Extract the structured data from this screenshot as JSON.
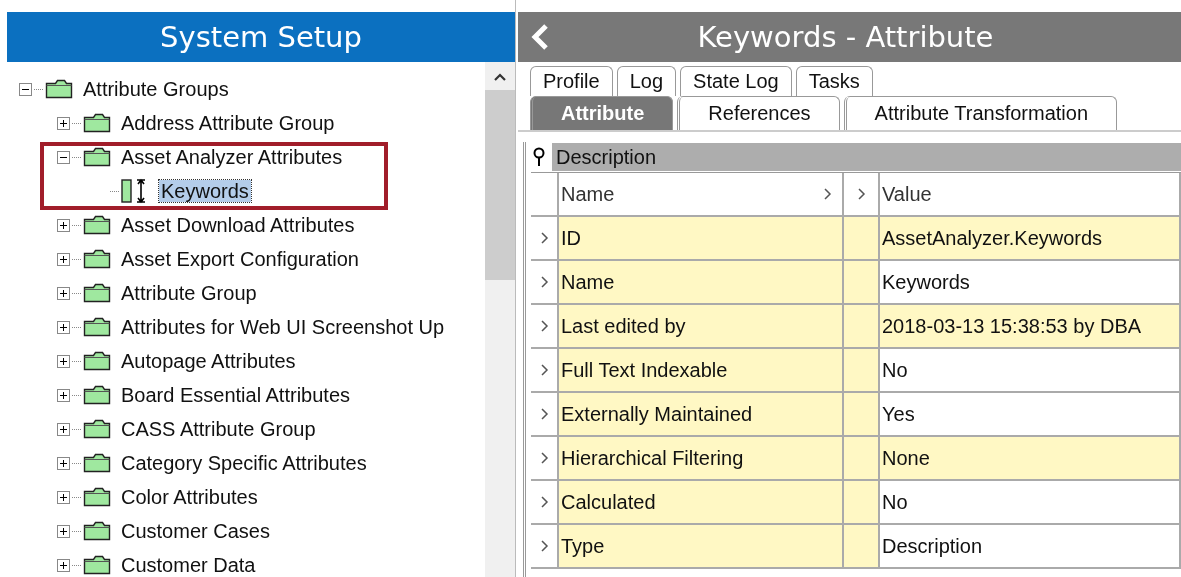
{
  "left_panel": {
    "title": "System Setup",
    "tree": [
      {
        "label": "Attribute Groups",
        "kind": "folder",
        "expanded": true,
        "selected": false,
        "children": [
          {
            "label": "Address Attribute Group",
            "kind": "folder",
            "expanded": false,
            "selected": false
          },
          {
            "label": "Asset Analyzer Attributes",
            "kind": "folder",
            "expanded": true,
            "selected": false,
            "children": [
              {
                "label": "Keywords",
                "kind": "attribute",
                "selected": true
              }
            ]
          },
          {
            "label": "Asset Download Attributes",
            "kind": "folder",
            "expanded": false,
            "selected": false
          },
          {
            "label": "Asset Export Configuration",
            "kind": "folder",
            "expanded": false,
            "selected": false
          },
          {
            "label": "Attribute Group",
            "kind": "folder",
            "expanded": false,
            "selected": false
          },
          {
            "label": "Attributes for Web UI Screenshot Up",
            "kind": "folder",
            "expanded": false,
            "selected": false
          },
          {
            "label": "Autopage Attributes",
            "kind": "folder",
            "expanded": false,
            "selected": false
          },
          {
            "label": "Board Essential Attributes",
            "kind": "folder",
            "expanded": false,
            "selected": false
          },
          {
            "label": "CASS Attribute Group",
            "kind": "folder",
            "expanded": false,
            "selected": false
          },
          {
            "label": "Category Specific Attributes",
            "kind": "folder",
            "expanded": false,
            "selected": false
          },
          {
            "label": "Color Attributes",
            "kind": "folder",
            "expanded": false,
            "selected": false
          },
          {
            "label": "Customer Cases",
            "kind": "folder",
            "expanded": false,
            "selected": false
          },
          {
            "label": "Customer Data",
            "kind": "folder",
            "expanded": false,
            "selected": false
          }
        ]
      }
    ]
  },
  "right_panel": {
    "title": "Keywords - Attribute",
    "tabs_row_1": [
      {
        "label": "Profile",
        "selected": false
      },
      {
        "label": "Log",
        "selected": false
      },
      {
        "label": "State Log",
        "selected": false
      },
      {
        "label": "Tasks",
        "selected": false
      }
    ],
    "tabs_row_2": [
      {
        "label": "Attribute",
        "selected": true
      },
      {
        "label": "References",
        "selected": false
      },
      {
        "label": "Attribute Transformation",
        "selected": false
      }
    ],
    "section": "Description",
    "table": {
      "columns": [
        "Name",
        "Value"
      ],
      "rows": [
        {
          "name": "ID",
          "value": "AssetAnalyzer.Keywords",
          "read_only": true
        },
        {
          "name": "Name",
          "value": "Keywords",
          "read_only": false
        },
        {
          "name": "Last edited by",
          "value": "2018-03-13 15:38:53 by DBA",
          "read_only": true
        },
        {
          "name": "Full Text Indexable",
          "value": "No",
          "read_only": false
        },
        {
          "name": "Externally Maintained",
          "value": "Yes",
          "read_only": false
        },
        {
          "name": "Hierarchical Filtering",
          "value": "None",
          "read_only": true
        },
        {
          "name": "Calculated",
          "value": "No",
          "read_only": false
        },
        {
          "name": "Type",
          "value": "Description",
          "read_only": false
        }
      ]
    }
  }
}
